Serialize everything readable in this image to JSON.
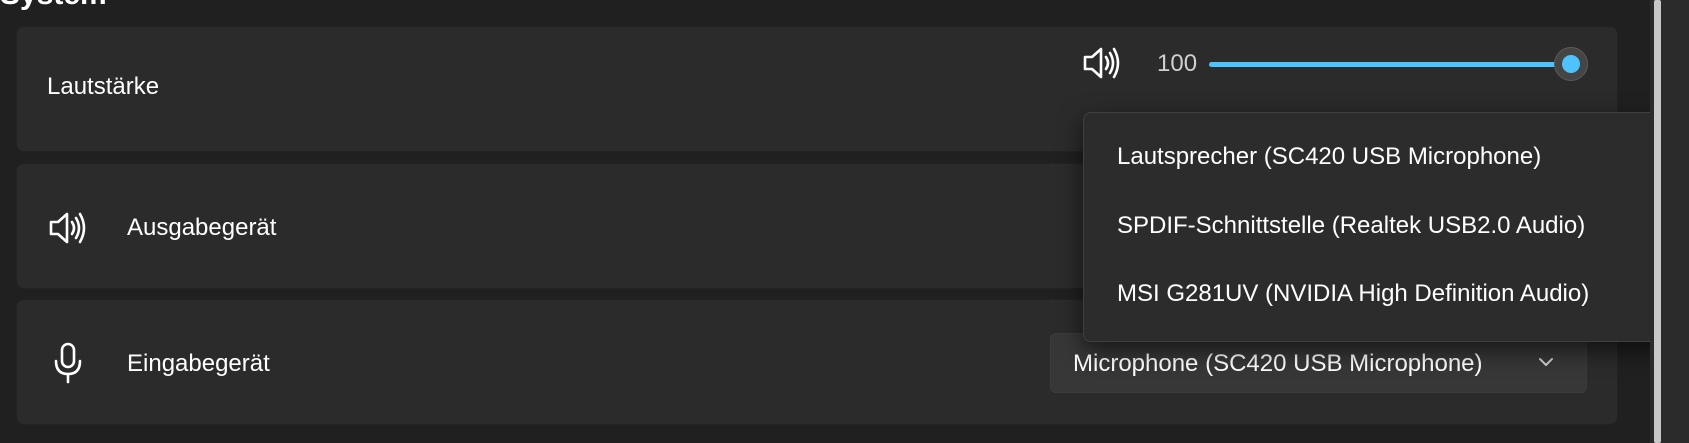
{
  "section": {
    "title": "System"
  },
  "volume": {
    "label": "Lautstärke",
    "icon": "speaker-icon",
    "value": 100,
    "value_text": "100",
    "accent": "#4cc2ff"
  },
  "output": {
    "label": "Ausgabegerät",
    "icon": "speaker-icon"
  },
  "input": {
    "label": "Eingabegerät",
    "icon": "microphone-icon",
    "selected": "Microphone (SC420 USB Microphone)",
    "chevron": "chevron-down-icon"
  },
  "flyout": {
    "items": [
      "Lautsprecher (SC420 USB Microphone)",
      "SPDIF-Schnittstelle (Realtek USB2.0 Audio)",
      "MSI G281UV (NVIDIA High Definition Audio)"
    ]
  }
}
